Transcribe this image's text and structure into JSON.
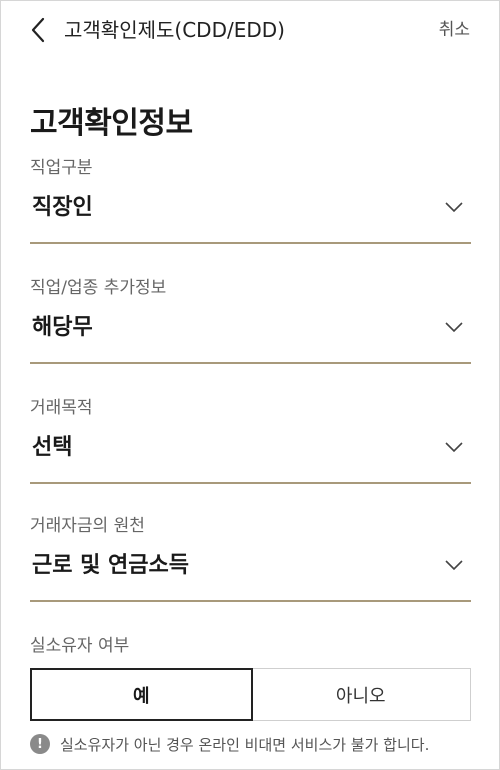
{
  "header": {
    "title": "고객확인제도(CDD/EDD)",
    "cancel_label": "취소"
  },
  "page_title": "고객확인정보",
  "fields": [
    {
      "label": "직업구분",
      "value": "직장인"
    },
    {
      "label": "직업/업종 추가정보",
      "value": "해당무"
    },
    {
      "label": "거래목적",
      "value": "선택"
    },
    {
      "label": "거래자금의 원천",
      "value": "근로 및 연금소득"
    }
  ],
  "owner_question": {
    "label": "실소유자 여부",
    "options": [
      "예",
      "아니오"
    ],
    "selected": "예"
  },
  "notice": {
    "icon": "!",
    "text": "실소유자가 아닌 경우 온라인 비대면 서비스가 불가 합니다."
  },
  "colors": {
    "underline": "#a8997b",
    "selected_border": "#222222"
  }
}
